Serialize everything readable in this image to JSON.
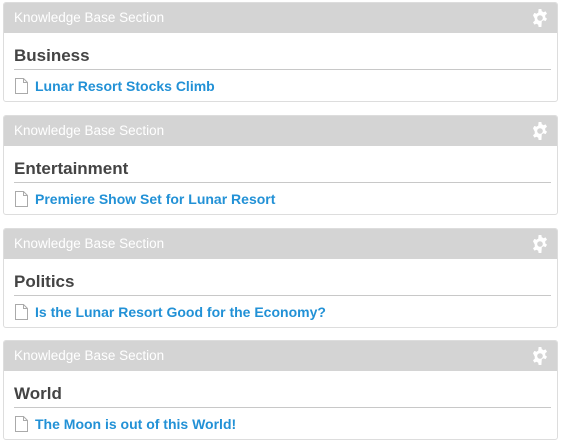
{
  "sections": [
    {
      "header_label": "Knowledge Base Section",
      "title": "Business",
      "article": "Lunar Resort Stocks Climb"
    },
    {
      "header_label": "Knowledge Base Section",
      "title": "Entertainment",
      "article": "Premiere Show Set for Lunar Resort"
    },
    {
      "header_label": "Knowledge Base Section",
      "title": "Politics",
      "article": "Is the Lunar Resort Good for the Economy?"
    },
    {
      "header_label": "Knowledge Base Section",
      "title": "World",
      "article": "The Moon is out of this World!"
    }
  ],
  "icons": {
    "settings": "gear-icon",
    "article": "document-icon"
  },
  "colors": {
    "header_bg": "#d4d4d4",
    "header_text": "#ffffff",
    "link": "#2291d6",
    "title": "#444444"
  }
}
